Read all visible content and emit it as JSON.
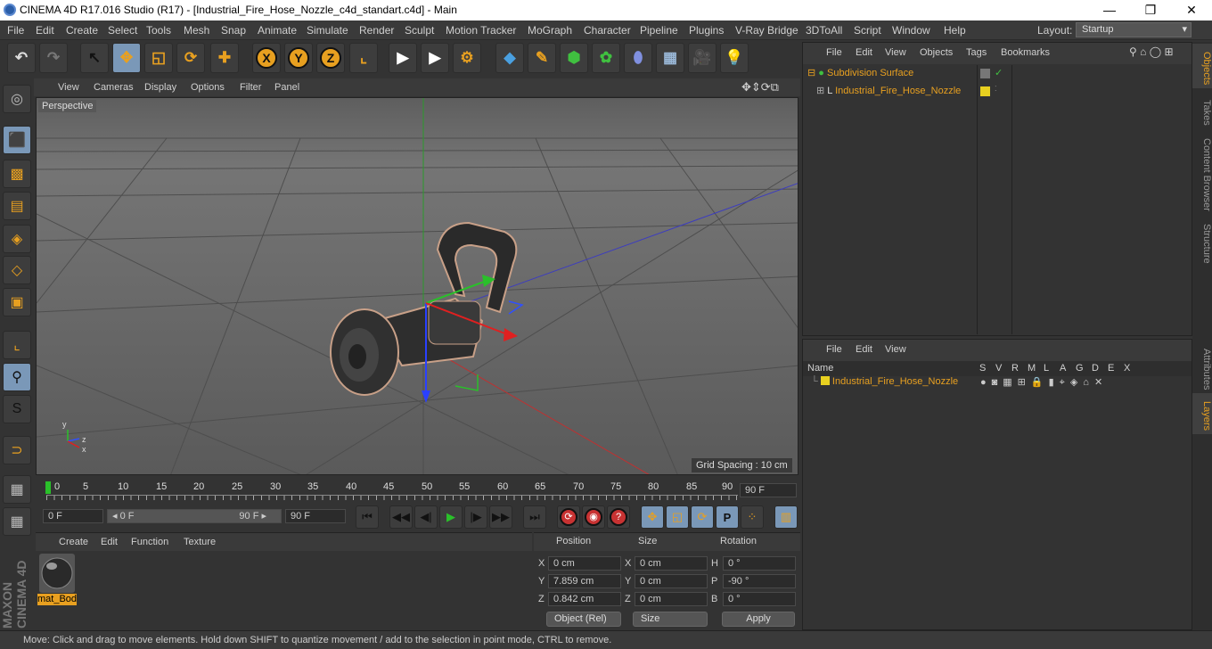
{
  "window": {
    "title": "CINEMA 4D R17.016 Studio (R17) - [Industrial_Fire_Hose_Nozzle_c4d_standart.c4d] - Main",
    "minimize": "—",
    "maximize": "❐",
    "close": "✕"
  },
  "menu": [
    "File",
    "Edit",
    "Create",
    "Select",
    "Tools",
    "Mesh",
    "Snap",
    "Animate",
    "Simulate",
    "Render",
    "Sculpt",
    "Motion Tracker",
    "MoGraph",
    "Character",
    "Pipeline",
    "Plugins",
    "V-Ray Bridge",
    "3DToAll",
    "Script",
    "Window",
    "Help"
  ],
  "layout": {
    "label": "Layout:",
    "value": "Startup"
  },
  "toolbar": {
    "undo_icon": "↶",
    "redo_icon": "↷",
    "select_icon": "↖",
    "move_icon": "✥",
    "scale_icon": "◱",
    "rotate_icon": "⟳",
    "add_icon": "✚",
    "x_label": "X",
    "y_label": "Y",
    "z_label": "Z",
    "coord_icon": "⌞",
    "render_view_icon": "▶",
    "render_picture_icon": "▶",
    "render_settings_icon": "⚙",
    "cube_icon": "◆",
    "pen_icon": "✎",
    "subdiv_icon": "⬢",
    "cloner_icon": "✿",
    "deformer_icon": "⬮",
    "floor_icon": "▦",
    "camera_icon": "🎥",
    "light_icon": "💡"
  },
  "viewport": {
    "menu": [
      "View",
      "Cameras",
      "Display",
      "Options",
      "Filter",
      "Panel"
    ],
    "label": "Perspective",
    "grid_spacing": "Grid Spacing : 10 cm",
    "axis_x": "x",
    "axis_y": "y",
    "axis_z": "z"
  },
  "left_toolbar": {
    "icons": [
      "make-editable-icon",
      "model-mode-icon",
      "texture-mode-icon",
      "workplane-mode-icon",
      "points-mode-icon",
      "edges-mode-icon",
      "polygons-mode-icon",
      "axis-mode-icon",
      "tweak-mode-icon",
      "solo-mode-icon",
      "snap-icon",
      "lock-workplane-icon",
      "workplane-icon"
    ],
    "glyphs": [
      "◎",
      "⬛",
      "▩",
      "▤",
      "◈",
      "◇",
      "▣",
      "⌞",
      "⚲",
      "S",
      "⊃",
      "▦",
      "▦"
    ]
  },
  "timeline": {
    "ticks": [
      "0",
      "5",
      "10",
      "15",
      "20",
      "25",
      "30",
      "35",
      "40",
      "45",
      "50",
      "55",
      "60",
      "65",
      "70",
      "75",
      "80",
      "85",
      "90"
    ],
    "current_frame": "90 F"
  },
  "playback": {
    "start_field": "0 F",
    "range_start": "◂ 0 F",
    "range_end": "90 F ▸",
    "end_field": "90 F",
    "buttons": [
      "⏮",
      "◀◀",
      "◀|",
      "▶",
      "|▶",
      "▶▶",
      "⏭"
    ],
    "rec_buttons": [
      "⟳",
      "◉",
      "?"
    ],
    "key_buttons": [
      "✥",
      "◱",
      "⟳",
      "P",
      "⁘"
    ],
    "timeline_icon": "▥"
  },
  "material_manager": {
    "menu": [
      "Create",
      "Edit",
      "Function",
      "Texture"
    ],
    "materials": [
      {
        "name": "mat_Bod"
      }
    ]
  },
  "coordinates": {
    "headers": [
      "Position",
      "Size",
      "Rotation"
    ],
    "rows": [
      {
        "axis": "X",
        "pos": "0 cm",
        "size_axis": "X",
        "size": "0 cm",
        "rot_axis": "H",
        "rot": "0 °"
      },
      {
        "axis": "Y",
        "pos": "7.859 cm",
        "size_axis": "Y",
        "size": "0 cm",
        "rot_axis": "P",
        "rot": "-90 °"
      },
      {
        "axis": "Z",
        "pos": "0.842 cm",
        "size_axis": "Z",
        "size": "0 cm",
        "rot_axis": "B",
        "rot": "0 °"
      }
    ],
    "mode": "Object (Rel)",
    "size_mode": "Size",
    "apply": "Apply"
  },
  "object_manager": {
    "menu": [
      "File",
      "Edit",
      "View",
      "Objects",
      "Tags",
      "Bookmarks"
    ],
    "objects": [
      {
        "name": "Subdivision Surface"
      },
      {
        "name": "Industrial_Fire_Hose_Nozzle"
      }
    ],
    "expand_icons": [
      "⊟",
      "⊞"
    ],
    "status_icons": [
      "✓"
    ]
  },
  "layer_manager": {
    "menu": [
      "File",
      "Edit",
      "View"
    ],
    "name_header": "Name",
    "columns": [
      "S",
      "V",
      "R",
      "M",
      "L",
      "A",
      "G",
      "D",
      "E",
      "X"
    ],
    "layers": [
      {
        "name": "Industrial_Fire_Hose_Nozzle",
        "color": "#e8d020"
      }
    ]
  },
  "right_tabs": [
    "Objects",
    "Takes",
    "Content Browser",
    "Structure",
    "Attributes",
    "Layers"
  ],
  "status_text": "Move: Click and drag to move elements. Hold down SHIFT to quantize movement / add to the selection in point mode, CTRL to remove.",
  "brand": "MAXON CINEMA 4D",
  "colors": {
    "accent": "#e8a020",
    "selected_obj": "#e8a020",
    "highlight": "#7a98b8"
  }
}
